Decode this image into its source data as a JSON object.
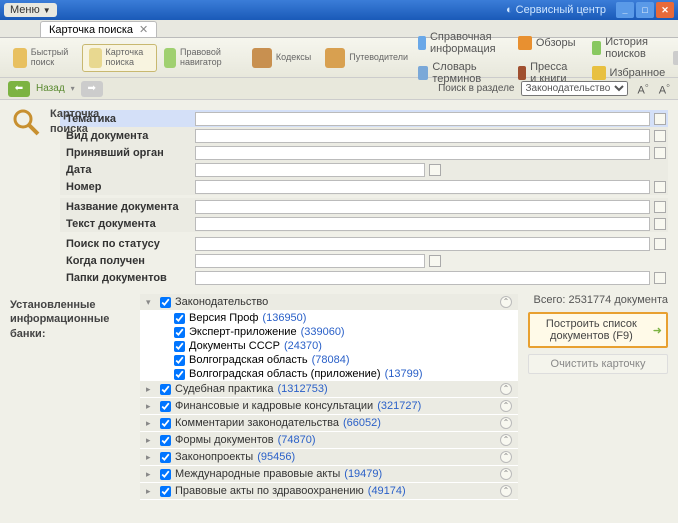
{
  "window": {
    "menu": "Меню",
    "service_center": "Сервисный центр"
  },
  "tab": {
    "title": "Карточка поиска"
  },
  "toolbar": {
    "quick_search": "Быстрый\nпоиск",
    "search_card": "Карточка\nпоиска",
    "legal_nav": "Правовой\nнавигатор",
    "codex": "Кодексы",
    "guides": "Путеводители",
    "ref_info": "Справочная информация",
    "dict": "Словарь терминов",
    "reviews": "Обзоры",
    "press": "Пресса и книги",
    "history": "История поисков",
    "fav": "Избранное",
    "add": "Добавить"
  },
  "nav": {
    "back": "Назад",
    "section_label": "Поиск в разделе",
    "section_value": "Законодательство"
  },
  "card": {
    "title1": "Карточка",
    "title2": "поиска"
  },
  "fields": {
    "tema": "Тематика",
    "vid": "Вид документа",
    "organ": "Принявший орган",
    "date": "Дата",
    "nomer": "Номер",
    "name": "Название документа",
    "text": "Текст документа",
    "status": "Поиск по статусу",
    "received": "Когда получен",
    "folders": "Папки документов"
  },
  "banks_label": "Установленные информационные банки:",
  "tree": [
    {
      "name": "Законодательство",
      "expanded": true,
      "children": [
        {
          "name": "Версия Проф",
          "count": "136950"
        },
        {
          "name": "Эксперт-приложение",
          "count": "339060"
        },
        {
          "name": "Документы СССР",
          "count": "24370"
        },
        {
          "name": "Волгоградская область",
          "count": "78084"
        },
        {
          "name": "Волгоградская область (приложение)",
          "count": "13799"
        }
      ]
    },
    {
      "name": "Судебная практика",
      "count": "1312753"
    },
    {
      "name": "Финансовые и кадровые консультации",
      "count": "321727"
    },
    {
      "name": "Комментарии законодательства",
      "count": "66052"
    },
    {
      "name": "Формы документов",
      "count": "74870"
    },
    {
      "name": "Законопроекты",
      "count": "95456"
    },
    {
      "name": "Международные правовые акты",
      "count": "19479"
    },
    {
      "name": "Правовые акты по здравоохранению",
      "count": "49174"
    }
  ],
  "right": {
    "total": "Всего: 2531774 документа",
    "build": "Построить список документов (F9)",
    "clear": "Очистить карточку"
  }
}
